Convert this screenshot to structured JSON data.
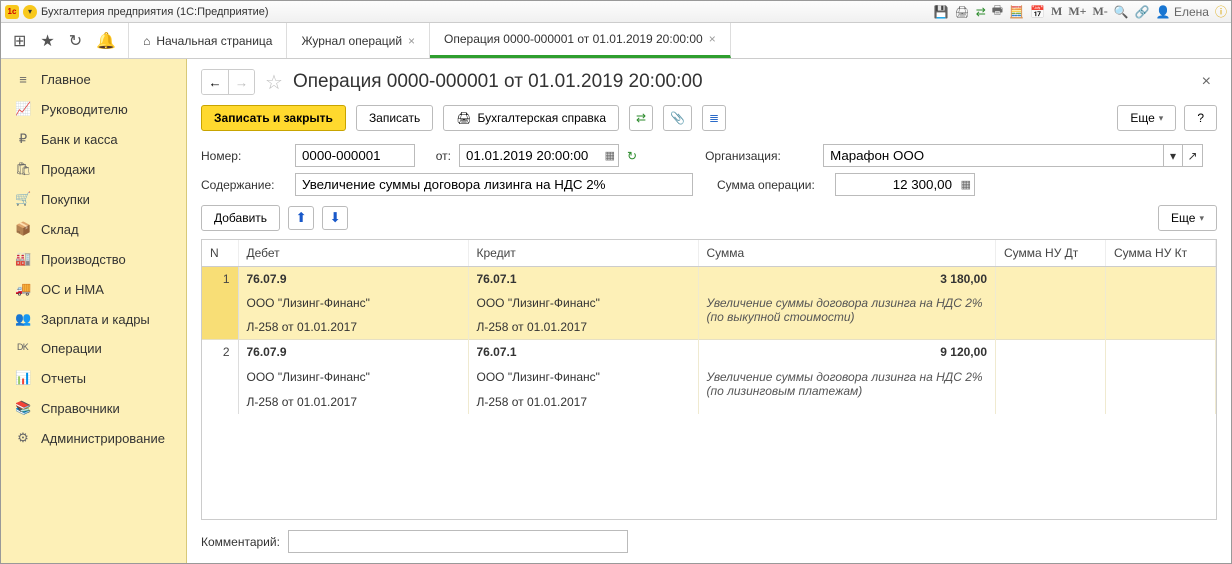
{
  "titlebar": {
    "title": "Бухгалтерия предприятия  (1С:Предприятие)",
    "user": "Елена",
    "m": [
      "M",
      "M+",
      "M-"
    ]
  },
  "tabs": {
    "home": "Начальная страница",
    "t1": "Журнал операций",
    "t2": "Операция 0000-000001 от 01.01.2019 20:00:00"
  },
  "sidebar": {
    "items": [
      {
        "icon": "≡",
        "label": "Главное"
      },
      {
        "icon": "📈",
        "label": "Руководителю"
      },
      {
        "icon": "₽",
        "label": "Банк и касса"
      },
      {
        "icon": "🛍",
        "label": "Продажи"
      },
      {
        "icon": "🛒",
        "label": "Покупки"
      },
      {
        "icon": "📦",
        "label": "Склад"
      },
      {
        "icon": "🏭",
        "label": "Производство"
      },
      {
        "icon": "🚚",
        "label": "ОС и НМА"
      },
      {
        "icon": "👥",
        "label": "Зарплата и кадры"
      },
      {
        "icon": "ᴰᴷ",
        "label": "Операции"
      },
      {
        "icon": "📊",
        "label": "Отчеты"
      },
      {
        "icon": "📚",
        "label": "Справочники"
      },
      {
        "icon": "⚙",
        "label": "Администрирование"
      }
    ]
  },
  "doc": {
    "title": "Операция 0000-000001 от 01.01.2019 20:00:00",
    "btn_save_close": "Записать и закрыть",
    "btn_save": "Записать",
    "btn_ref": "Бухгалтерская справка",
    "btn_more": "Еще",
    "btn_help": "?",
    "lbl_number": "Номер:",
    "number": "0000-000001",
    "lbl_from": "от:",
    "date": "01.01.2019 20:00:00",
    "lbl_org": "Организация:",
    "org": "Марафон ООО",
    "lbl_content": "Содержание:",
    "content": "Увеличение суммы договора лизинга на НДС 2%",
    "lbl_sum": "Сумма операции:",
    "sum": "12 300,00",
    "btn_add": "Добавить",
    "lbl_comment": "Комментарий:",
    "comment_value": ""
  },
  "grid": {
    "headers": {
      "n": "N",
      "debit": "Дебет",
      "credit": "Кредит",
      "sum": "Сумма",
      "sum_nu_dt": "Сумма НУ Дт",
      "sum_nu_kt": "Сумма НУ Кт"
    },
    "rows": [
      {
        "n": "1",
        "selected": true,
        "debit_acc": "76.07.9",
        "credit_acc": "76.07.1",
        "sum": "3 180,00",
        "debit_sub1": "ООО \"Лизинг-Финанс\"",
        "credit_sub1": "ООО \"Лизинг-Финанс\"",
        "desc": "Увеличение суммы договора лизинга на НДС 2% (по выкупной стоимости)",
        "debit_sub2": "Л-258 от 01.01.2017",
        "credit_sub2": "Л-258 от 01.01.2017"
      },
      {
        "n": "2",
        "selected": false,
        "debit_acc": "76.07.9",
        "credit_acc": "76.07.1",
        "sum": "9 120,00",
        "debit_sub1": "ООО \"Лизинг-Финанс\"",
        "credit_sub1": "ООО \"Лизинг-Финанс\"",
        "desc": "Увеличение суммы договора лизинга на НДС 2% (по лизинговым платежам)",
        "debit_sub2": "Л-258 от 01.01.2017",
        "credit_sub2": "Л-258 от 01.01.2017"
      }
    ]
  }
}
